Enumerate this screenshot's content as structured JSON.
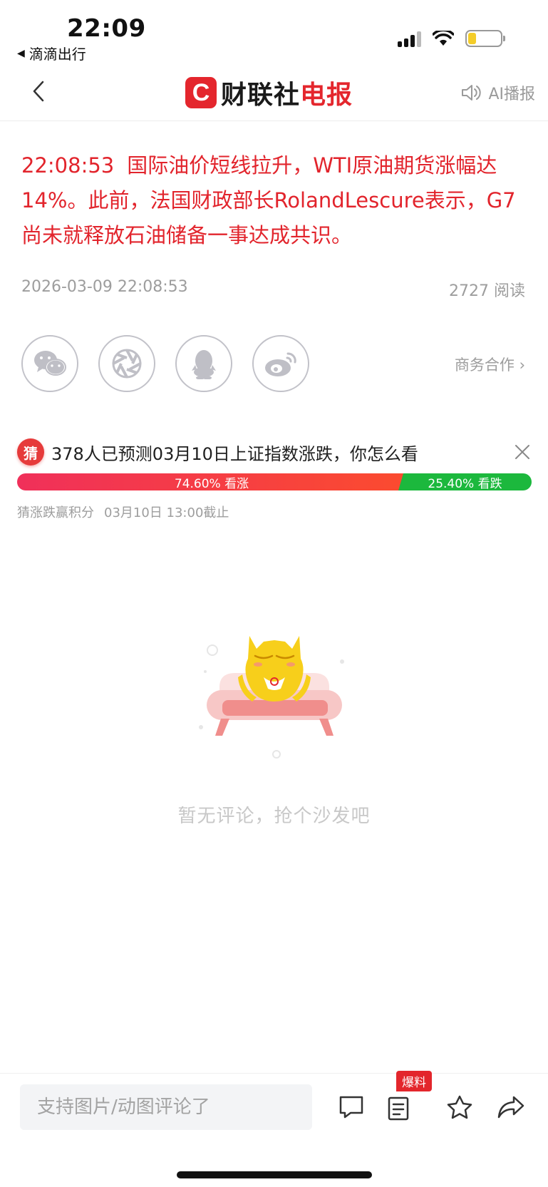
{
  "status_bar": {
    "time": "22:09",
    "back_app_label": "滴滴出行",
    "back_app_arrow": "◀",
    "battery_level": 0.2,
    "battery_color": "#f4cd2a"
  },
  "header": {
    "logo_mark": "C",
    "logo_text_a": "财联社",
    "logo_text_b": "电报",
    "ai_play_label": "AI播报",
    "brand_color": "#e4262d"
  },
  "article": {
    "time": "22:08:53",
    "text": "国际油价短线拉升，WTI原油期货涨幅达14%。此前，法国财政部长RolandLescure表示，G7尚未就释放石油储备一事达成共识。",
    "datetime": "2026-03-09 22:08:53",
    "reads": "2727 阅读"
  },
  "share": {
    "buttons": [
      "wechat-icon",
      "moments-icon",
      "qq-icon",
      "weibo-icon"
    ],
    "business_link": "商务合作 ›"
  },
  "prediction": {
    "badge": "猜",
    "title": "378人已预测03月10日上证指数涨跌，你怎么看",
    "up_label": "74.60% 看涨",
    "down_label": "25.40% 看跌",
    "up_share": 74.6,
    "down_share": 25.4,
    "up_color": "#f0305a",
    "down_color": "#1cb83d",
    "foot_left": "猜涨跌赢积分",
    "foot_right": "03月10日 13:00截止"
  },
  "comments": {
    "empty_text": "暂无评论，抢个沙发吧"
  },
  "bottom_bar": {
    "input_placeholder": "支持图片/动图评论了",
    "baoliao_label": "爆料"
  }
}
